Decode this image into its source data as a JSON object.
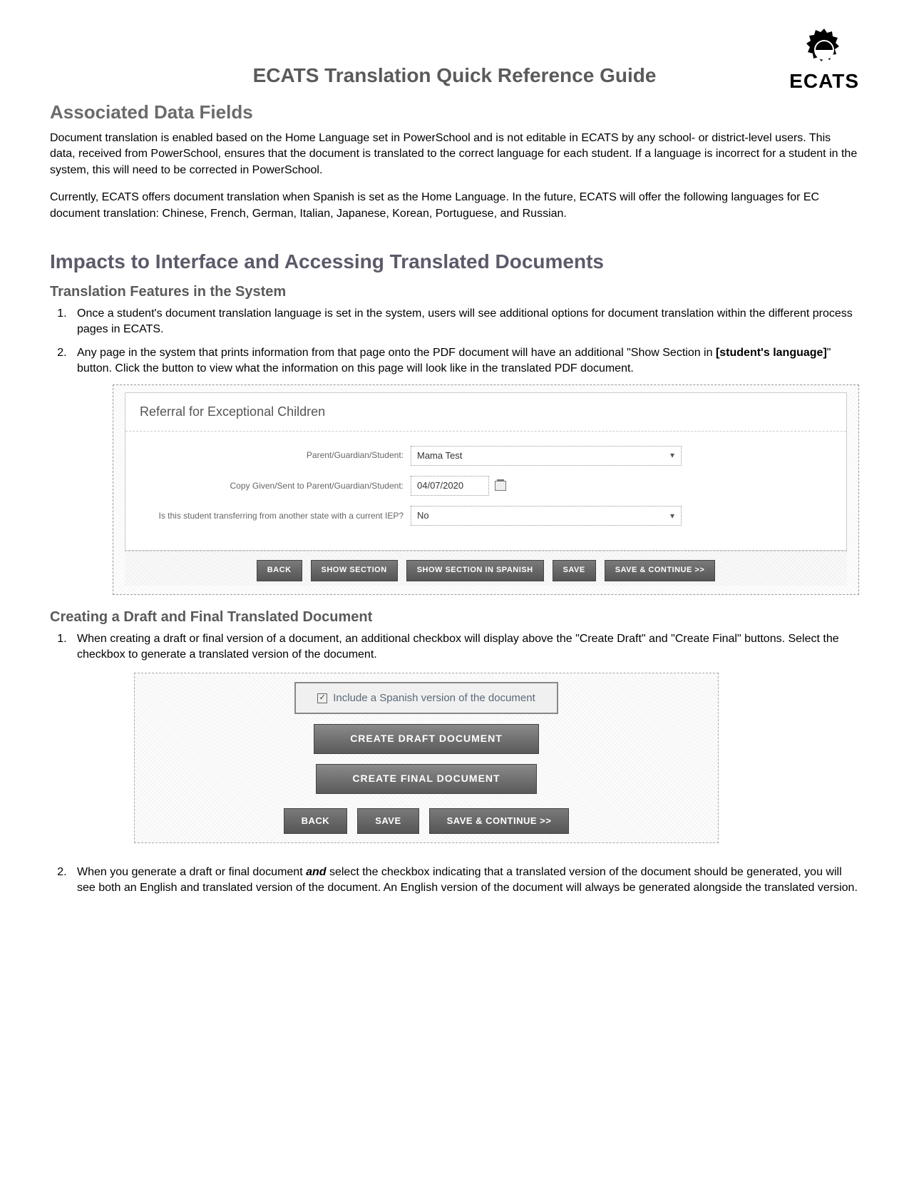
{
  "logo_text": "ECATS",
  "title": "ECATS Translation Quick Reference Guide",
  "sec1_heading": "Associated Data Fields",
  "sec1_p1": "Document translation is enabled based on the Home Language set in PowerSchool and is not editable in ECATS by any school- or district-level users. This data, received from PowerSchool, ensures that the document is translated to the correct language for each student. If a language is incorrect for a student in the system, this will need to be corrected in PowerSchool.",
  "sec1_p2": "Currently, ECATS offers document translation when Spanish is set as the Home Language. In the future, ECATS will offer the following languages for EC document translation: Chinese, French, German, Italian, Japanese, Korean, Portuguese, and Russian.",
  "sec2_heading": "Impacts to Interface and Accessing Translated Documents",
  "sec2_sub1": "Translation Features in the System",
  "sec2_li1": "Once a student's document translation language is set in the system, users will see additional options for document translation within the different process pages in ECATS.",
  "sec2_li2_a": "Any page in the system that prints information from that page onto the PDF document will have an additional \"Show Section in ",
  "sec2_li2_bold": "[student's language]",
  "sec2_li2_b": "\" button. Click the button to view what the information on this page will look like in the translated PDF document.",
  "shot1": {
    "panel_title": "Referral for Exceptional Children",
    "row1_label": "Parent/Guardian/Student:",
    "row1_value": "Mama Test",
    "row2_label": "Copy Given/Sent to Parent/Guardian/Student:",
    "row2_value": "04/07/2020",
    "row3_label": "Is this student transferring from another state with a current IEP?",
    "row3_value": "No",
    "btn_back": "BACK",
    "btn_show": "SHOW SECTION",
    "btn_show_es": "SHOW SECTION IN SPANISH",
    "btn_save": "SAVE",
    "btn_save_cont": "SAVE & CONTINUE >>"
  },
  "sec2_sub2": "Creating a Draft and Final Translated Document",
  "sec2b_li1": "When creating a draft or final version of a document, an additional checkbox will display above the \"Create Draft\" and \"Create Final\" buttons. Select the checkbox to generate a translated version of the document.",
  "shot2": {
    "checkbox_label": "Include a Spanish version of the document",
    "btn_draft": "CREATE DRAFT DOCUMENT",
    "btn_final": "CREATE FINAL DOCUMENT",
    "btn_back": "BACK",
    "btn_save": "SAVE",
    "btn_save_cont": "SAVE & CONTINUE >>"
  },
  "sec2b_li2_a": "When you generate a draft or final document ",
  "sec2b_li2_bold": "and",
  "sec2b_li2_b": " select the checkbox indicating that a translated version of the document should be generated, you will see both an English and translated version of the document. An English version of the document will always be generated alongside the translated version."
}
